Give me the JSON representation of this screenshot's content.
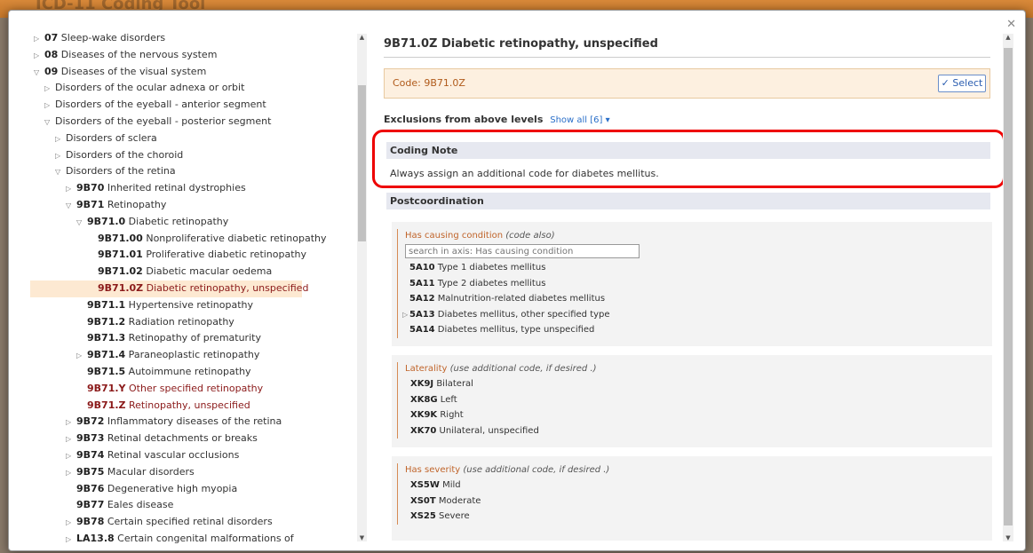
{
  "background_title": "ICD-11 Coding Tool",
  "tree": [
    {
      "indent": 0,
      "toggle": "▷",
      "code": "07",
      "label": " Sleep-wake disorders",
      "style": ""
    },
    {
      "indent": 0,
      "toggle": "▷",
      "code": "08",
      "label": " Diseases of the nervous system",
      "style": ""
    },
    {
      "indent": 0,
      "toggle": "▽",
      "code": "09",
      "label": " Diseases of the visual system",
      "style": ""
    },
    {
      "indent": 1,
      "toggle": "▷",
      "code": "",
      "label": "Disorders of the ocular adnexa or orbit",
      "style": ""
    },
    {
      "indent": 1,
      "toggle": "▷",
      "code": "",
      "label": "Disorders of the eyeball - anterior segment",
      "style": ""
    },
    {
      "indent": 1,
      "toggle": "▽",
      "code": "",
      "label": "Disorders of the eyeball - posterior segment",
      "style": ""
    },
    {
      "indent": 2,
      "toggle": "▷",
      "code": "",
      "label": "Disorders of sclera",
      "style": ""
    },
    {
      "indent": 2,
      "toggle": "▷",
      "code": "",
      "label": "Disorders of the choroid",
      "style": ""
    },
    {
      "indent": 2,
      "toggle": "▽",
      "code": "",
      "label": "Disorders of the retina",
      "style": ""
    },
    {
      "indent": 3,
      "toggle": "▷",
      "code": "9B70",
      "label": " Inherited retinal dystrophies",
      "style": ""
    },
    {
      "indent": 3,
      "toggle": "▽",
      "code": "9B71",
      "label": " Retinopathy",
      "style": ""
    },
    {
      "indent": 4,
      "toggle": "▽",
      "code": "9B71.0",
      "label": " Diabetic retinopathy",
      "style": ""
    },
    {
      "indent": 5,
      "toggle": "",
      "code": "9B71.00",
      "label": " Nonproliferative diabetic retinopathy",
      "style": ""
    },
    {
      "indent": 5,
      "toggle": "",
      "code": "9B71.01",
      "label": " Proliferative diabetic retinopathy",
      "style": ""
    },
    {
      "indent": 5,
      "toggle": "",
      "code": "9B71.02",
      "label": " Diabetic macular oedema",
      "style": ""
    },
    {
      "indent": 5,
      "toggle": "",
      "code": "9B71.0Z",
      "label": " Diabetic retinopathy, unspecified",
      "style": "sel"
    },
    {
      "indent": 4,
      "toggle": "",
      "code": "9B71.1",
      "label": " Hypertensive retinopathy",
      "style": ""
    },
    {
      "indent": 4,
      "toggle": "",
      "code": "9B71.2",
      "label": " Radiation retinopathy",
      "style": ""
    },
    {
      "indent": 4,
      "toggle": "",
      "code": "9B71.3",
      "label": " Retinopathy of prematurity",
      "style": ""
    },
    {
      "indent": 4,
      "toggle": "▷",
      "code": "9B71.4",
      "label": " Paraneoplastic retinopathy",
      "style": ""
    },
    {
      "indent": 4,
      "toggle": "",
      "code": "9B71.5",
      "label": " Autoimmune retinopathy",
      "style": ""
    },
    {
      "indent": 4,
      "toggle": "",
      "code": "9B71.Y",
      "label": " Other specified retinopathy",
      "style": "red"
    },
    {
      "indent": 4,
      "toggle": "",
      "code": "9B71.Z",
      "label": " Retinopathy, unspecified",
      "style": "red"
    },
    {
      "indent": 3,
      "toggle": "▷",
      "code": "9B72",
      "label": " Inflammatory diseases of the retina",
      "style": ""
    },
    {
      "indent": 3,
      "toggle": "▷",
      "code": "9B73",
      "label": " Retinal detachments or breaks",
      "style": ""
    },
    {
      "indent": 3,
      "toggle": "▷",
      "code": "9B74",
      "label": " Retinal vascular occlusions",
      "style": ""
    },
    {
      "indent": 3,
      "toggle": "▷",
      "code": "9B75",
      "label": " Macular disorders",
      "style": ""
    },
    {
      "indent": 3,
      "toggle": "",
      "code": "9B76",
      "label": " Degenerative high myopia",
      "style": ""
    },
    {
      "indent": 3,
      "toggle": "",
      "code": "9B77",
      "label": " Eales disease",
      "style": ""
    },
    {
      "indent": 3,
      "toggle": "▷",
      "code": "9B78",
      "label": " Certain specified retinal disorders",
      "style": ""
    },
    {
      "indent": 3,
      "toggle": "▷",
      "code": "LA13.8",
      "label": " Certain congenital malformations of",
      "style": ""
    }
  ],
  "detail": {
    "title": "9B71.0Z Diabetic retinopathy, unspecified",
    "code_label": "Code: 9B71.0Z",
    "select_label": "✓ Select",
    "exclusions_label": "Exclusions from above levels",
    "show_all": "Show all [6] ▾",
    "coding_note_head": "Coding Note",
    "coding_note_text": "Always assign an additional code for diabetes mellitus.",
    "postcoord_head": "Postcoordination",
    "causing": {
      "title": "Has causing condition",
      "hint": "(code also)",
      "placeholder": "search in axis: Has causing condition",
      "items": [
        {
          "toggle": "",
          "code": "5A10",
          "label": " Type 1 diabetes mellitus"
        },
        {
          "toggle": "",
          "code": "5A11",
          "label": " Type 2 diabetes mellitus"
        },
        {
          "toggle": "",
          "code": "5A12",
          "label": " Malnutrition-related diabetes mellitus"
        },
        {
          "toggle": "▷",
          "code": "5A13",
          "label": " Diabetes mellitus, other specified type"
        },
        {
          "toggle": "",
          "code": "5A14",
          "label": " Diabetes mellitus, type unspecified"
        }
      ]
    },
    "laterality": {
      "title": "Laterality",
      "hint": "(use additional code, if desired .)",
      "items": [
        {
          "code": "XK9J",
          "label": " Bilateral"
        },
        {
          "code": "XK8G",
          "label": " Left"
        },
        {
          "code": "XK9K",
          "label": " Right"
        },
        {
          "code": "XK70",
          "label": " Unilateral, unspecified"
        }
      ]
    },
    "severity": {
      "title": "Has severity",
      "hint": "(use additional code, if desired .)",
      "items": [
        {
          "code": "XS5W",
          "label": " Mild"
        },
        {
          "code": "XS0T",
          "label": " Moderate"
        },
        {
          "code": "XS25",
          "label": " Severe"
        }
      ]
    }
  }
}
